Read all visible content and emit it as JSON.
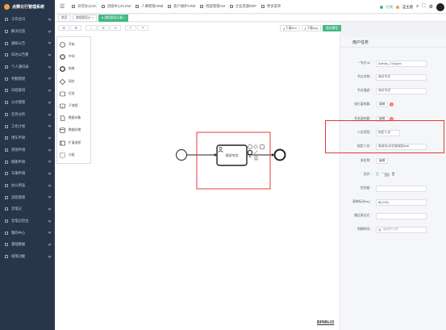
{
  "app": {
    "title": "点狮云行管理系统"
  },
  "sidebar": {
    "items": [
      {
        "label": "工作台司"
      },
      {
        "label": "解决信息"
      },
      {
        "label": "通知公告"
      },
      {
        "label": "日达公告看"
      },
      {
        "label": "个人通讯录"
      },
      {
        "label": "考勤管理"
      },
      {
        "label": "日程安排"
      },
      {
        "label": "公文管理"
      },
      {
        "label": "任务分析"
      },
      {
        "label": "工作计划"
      },
      {
        "label": "用车申请"
      },
      {
        "label": "资销申请"
      },
      {
        "label": "假期申请"
      },
      {
        "label": "车辆申请"
      },
      {
        "label": "办公用品"
      },
      {
        "label": "流程管理"
      },
      {
        "label": "云笔记"
      },
      {
        "label": "云笔记后台"
      },
      {
        "label": "我的中心"
      },
      {
        "label": "基础数据"
      },
      {
        "label": "权限功能"
      }
    ]
  },
  "topbar": {
    "menus": [
      {
        "label": "日常办公OA"
      },
      {
        "label": "流程中心FLOW"
      },
      {
        "label": "人事管理HRM"
      },
      {
        "label": "客户维护CRM"
      },
      {
        "label": "档案管理AM"
      },
      {
        "label": "企业资源ERP"
      },
      {
        "label": "更多菜单"
      }
    ],
    "online_label": "在线",
    "online_count": "1",
    "theme_label": "蓝主题",
    "badge": "99"
  },
  "tabs": [
    {
      "label": "首页"
    },
    {
      "label": "流程图设计 ×"
    },
    {
      "label": "● 流程图设计器 ×"
    }
  ],
  "toolbar": {
    "buttons": [
      "⊞",
      "✥",
      "↔",
      "⊕",
      "⊖",
      "↶",
      "↷"
    ],
    "download_xml": "⤓ 下载xml",
    "download_svg": "⤓ 下载svg",
    "save_model": "保存模型"
  },
  "palette": {
    "items": [
      {
        "label": "开始",
        "icon": "start-event-icon"
      },
      {
        "label": "中间",
        "icon": "intermediate-event-icon"
      },
      {
        "label": "结束",
        "icon": "end-event-icon"
      },
      {
        "label": "网关",
        "icon": "gateway-icon"
      },
      {
        "label": "任务",
        "icon": "task-icon"
      },
      {
        "label": "子流程",
        "icon": "subprocess-icon"
      },
      {
        "label": "数据对象",
        "icon": "data-object-icon"
      },
      {
        "label": "数据存储",
        "icon": "data-store-icon"
      },
      {
        "label": "扩展流程",
        "icon": "pool-icon"
      },
      {
        "label": "分组",
        "icon": "group-icon"
      }
    ]
  },
  "diagram": {
    "task_label": "测试节点"
  },
  "bpmn_logo": "BPMN.IO",
  "panel": {
    "title": "用户任务",
    "node_id_label": "* 节点 id：",
    "node_id_value": "Activity_17y4gno",
    "node_name_label": "节点名称：",
    "node_name_value": "测试节点",
    "node_desc_label": "节点描述：",
    "node_desc_value": "测试节点",
    "exec_listener_label": "执行监听器：",
    "exec_listener_btn": "编辑",
    "exec_listener_count": "0",
    "task_listener_label": "任务监听器：",
    "task_listener_btn": "编辑",
    "task_listener_count": "0",
    "person_type_label": "人员类型：",
    "person_type_value": "指定人员",
    "assignee_label": "指定人员：",
    "assignee_value": "管理员(项目管理部)odr",
    "multi_label": "多实例：",
    "multi_btn": "编辑",
    "async_label": "异步：",
    "async_no": "否",
    "async_yes": "是",
    "priority_label": "优先级：",
    "priority_value": "",
    "form_key_label": "表单标识key：",
    "form_key_value": "${1231}",
    "skip_label": "跳过表达式：",
    "skip_value": "",
    "due_label": "到期时间：",
    "due_placeholder": "请选择日期"
  }
}
